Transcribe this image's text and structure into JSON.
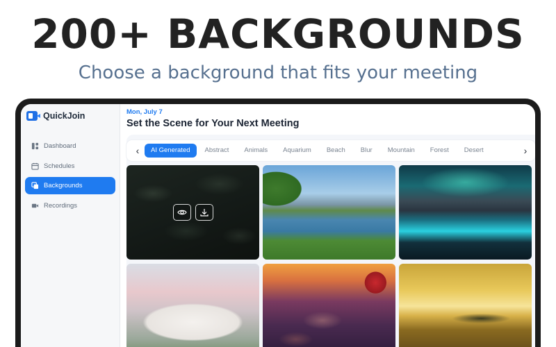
{
  "hero": {
    "headline": "200+ BACKGROUNDS",
    "subheadline": "Choose a background that fits your meeting"
  },
  "app": {
    "name": "QuickJoin",
    "accent": "#1f7bf0"
  },
  "sidebar": {
    "items": [
      {
        "label": "Dashboard",
        "icon": "dashboard-icon",
        "active": false
      },
      {
        "label": "Schedules",
        "icon": "calendar-icon",
        "active": false
      },
      {
        "label": "Backgrounds",
        "icon": "backgrounds-icon",
        "active": true
      },
      {
        "label": "Recordings",
        "icon": "video-camera-icon",
        "active": false
      }
    ]
  },
  "main": {
    "date": "Mon, July 7",
    "title": "Set the Scene for Your Next Meeting",
    "categories": [
      "AI Generated",
      "Abstract",
      "Animals",
      "Aquarium",
      "Beach",
      "Blur",
      "Mountain",
      "Forest",
      "Desert"
    ],
    "active_category": "AI Generated",
    "tiles": [
      {
        "scene": "dark palm leaves",
        "icon": "leaves"
      },
      {
        "scene": "mountain lake",
        "icon": "lake"
      },
      {
        "scene": "aurora over glacier lake",
        "icon": "aurora"
      },
      {
        "scene": "white organic house",
        "icon": "house"
      },
      {
        "scene": "red rocks at sunset",
        "icon": "rocks"
      },
      {
        "scene": "golden sunset over water",
        "icon": "sunset"
      }
    ],
    "tile_actions": [
      "preview-icon",
      "download-icon"
    ]
  }
}
